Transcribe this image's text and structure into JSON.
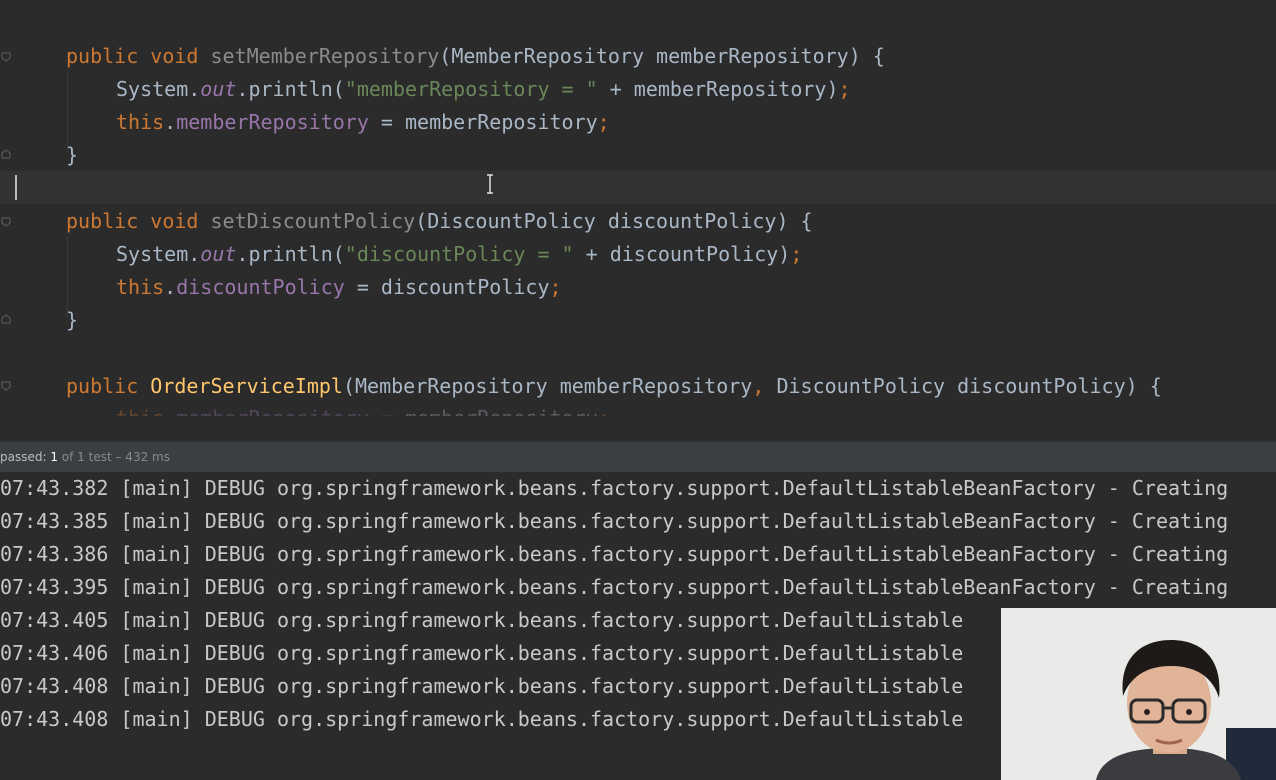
{
  "editor": {
    "lines": [
      {
        "parts": [
          [
            "kw",
            "public "
          ],
          [
            "kw",
            "void "
          ],
          [
            "fn-dim",
            "setMemberRepository"
          ],
          [
            "pl",
            "(MemberRepository memberRepository) {"
          ]
        ]
      },
      {
        "parts": [
          [
            "pl",
            "System."
          ],
          [
            "it",
            "out"
          ],
          [
            "pl",
            ".println("
          ],
          [
            "str",
            "\"memberRepository = \""
          ],
          [
            "pl",
            " + memberRepository)"
          ],
          [
            "kw",
            ";"
          ]
        ]
      },
      {
        "parts": [
          [
            "kw",
            "this"
          ],
          [
            "pl",
            "."
          ],
          [
            "fld",
            "memberRepository"
          ],
          [
            "pl",
            " = memberRepository"
          ],
          [
            "kw",
            ";"
          ]
        ]
      },
      {
        "parts": [
          [
            "pl",
            "}"
          ]
        ]
      },
      {
        "parts": [
          [
            "kw",
            "public "
          ],
          [
            "kw",
            "void "
          ],
          [
            "fn-dim",
            "setDiscountPolicy"
          ],
          [
            "pl",
            "(DiscountPolicy discountPolicy) {"
          ]
        ]
      },
      {
        "parts": [
          [
            "pl",
            "System."
          ],
          [
            "it",
            "out"
          ],
          [
            "pl",
            ".println("
          ],
          [
            "str",
            "\"discountPolicy = \""
          ],
          [
            "pl",
            " + discountPolicy)"
          ],
          [
            "kw",
            ";"
          ]
        ]
      },
      {
        "parts": [
          [
            "kw",
            "this"
          ],
          [
            "pl",
            "."
          ],
          [
            "fld",
            "discountPolicy"
          ],
          [
            "pl",
            " = discountPolicy"
          ],
          [
            "kw",
            ";"
          ]
        ]
      },
      {
        "parts": [
          [
            "pl",
            "}"
          ]
        ]
      },
      {
        "parts": [
          [
            "kw",
            "public "
          ],
          [
            "fn",
            "OrderServiceImpl"
          ],
          [
            "pl",
            "(MemberRepository memberRepository"
          ],
          [
            "kw",
            ", "
          ],
          [
            "pl",
            "DiscountPolicy discountPolicy) {"
          ]
        ]
      },
      {
        "parts": [
          [
            "kw",
            "this"
          ],
          [
            "pl",
            "."
          ],
          [
            "fld",
            "memberRepository"
          ],
          [
            "pl",
            " = memberRepository"
          ],
          [
            "kw",
            ";"
          ]
        ]
      }
    ]
  },
  "test_status": {
    "prefix": "passed: ",
    "count": "1",
    "suffix": " of 1 test – 432 ms"
  },
  "console": {
    "lines": [
      "07:43.382 [main] DEBUG org.springframework.beans.factory.support.DefaultListableBeanFactory - Creating",
      "07:43.385 [main] DEBUG org.springframework.beans.factory.support.DefaultListableBeanFactory - Creating",
      "07:43.386 [main] DEBUG org.springframework.beans.factory.support.DefaultListableBeanFactory - Creating",
      "07:43.395 [main] DEBUG org.springframework.beans.factory.support.DefaultListableBeanFactory - Creating",
      "07:43.405 [main] DEBUG org.springframework.beans.factory.support.DefaultListable",
      "07:43.406 [main] DEBUG org.springframework.beans.factory.support.DefaultListable",
      "07:43.408 [main] DEBUG org.springframework.beans.factory.support.DefaultListable",
      "07:43.408 [main] DEBUG org.springframework.beans.factory.support.DefaultListable"
    ]
  },
  "colors": {
    "keyword": "#cc7832",
    "string": "#6a8759",
    "field": "#9876aa",
    "method": "#ffc66d",
    "text": "#a9b7c6",
    "background": "#2b2b2b"
  }
}
